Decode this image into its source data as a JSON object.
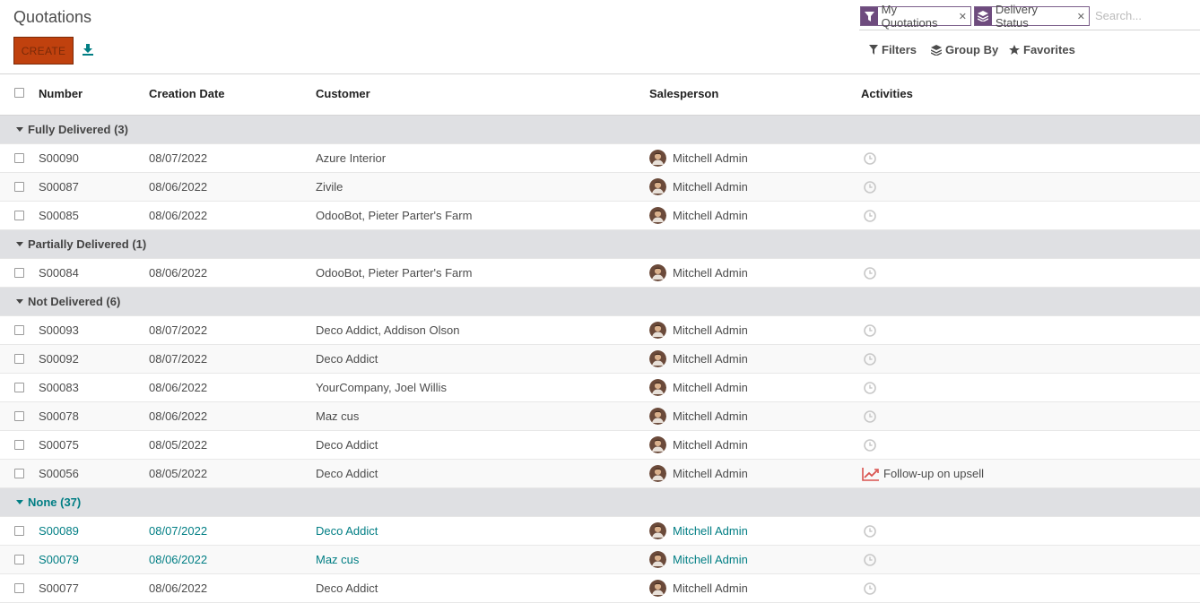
{
  "page": {
    "title": "Quotations"
  },
  "toolbar": {
    "create_label": "CREATE"
  },
  "search": {
    "facets": [
      {
        "label": "My Quotations",
        "icon": "filter-icon"
      },
      {
        "label": "Delivery Status",
        "icon": "layers-icon"
      }
    ],
    "placeholder": "Search...",
    "filters_label": "Filters",
    "groupby_label": "Group By",
    "favorites_label": "Favorites"
  },
  "table": {
    "headers": {
      "number": "Number",
      "date": "Creation Date",
      "customer": "Customer",
      "salesperson": "Salesperson",
      "activities": "Activities"
    },
    "groups": [
      {
        "label": "Fully Delivered (3)",
        "highlight": false,
        "rows": [
          {
            "number": "S00090",
            "date": "08/07/2022",
            "customer": "Azure Interior",
            "salesperson": "Mitchell Admin",
            "activity": ""
          },
          {
            "number": "S00087",
            "date": "08/06/2022",
            "customer": "Zivile",
            "salesperson": "Mitchell Admin",
            "activity": ""
          },
          {
            "number": "S00085",
            "date": "08/06/2022",
            "customer": "OdooBot, Pieter Parter's Farm",
            "salesperson": "Mitchell Admin",
            "activity": ""
          }
        ]
      },
      {
        "label": "Partially Delivered (1)",
        "highlight": false,
        "rows": [
          {
            "number": "S00084",
            "date": "08/06/2022",
            "customer": "OdooBot, Pieter Parter's Farm",
            "salesperson": "Mitchell Admin",
            "activity": ""
          }
        ]
      },
      {
        "label": "Not Delivered (6)",
        "highlight": false,
        "rows": [
          {
            "number": "S00093",
            "date": "08/07/2022",
            "customer": "Deco Addict, Addison Olson",
            "salesperson": "Mitchell Admin",
            "activity": ""
          },
          {
            "number": "S00092",
            "date": "08/07/2022",
            "customer": "Deco Addict",
            "salesperson": "Mitchell Admin",
            "activity": ""
          },
          {
            "number": "S00083",
            "date": "08/06/2022",
            "customer": "YourCompany, Joel Willis",
            "salesperson": "Mitchell Admin",
            "activity": ""
          },
          {
            "number": "S00078",
            "date": "08/06/2022",
            "customer": "Maz cus",
            "salesperson": "Mitchell Admin",
            "activity": ""
          },
          {
            "number": "S00075",
            "date": "08/05/2022",
            "customer": "Deco Addict",
            "salesperson": "Mitchell Admin",
            "activity": ""
          },
          {
            "number": "S00056",
            "date": "08/05/2022",
            "customer": "Deco Addict",
            "salesperson": "Mitchell Admin",
            "activity": "Follow-up on upsell"
          }
        ]
      },
      {
        "label": "None (37)",
        "highlight": true,
        "rows": [
          {
            "number": "S00089",
            "date": "08/07/2022",
            "customer": "Deco Addict",
            "salesperson": "Mitchell Admin",
            "activity": "",
            "teal": true
          },
          {
            "number": "S00079",
            "date": "08/06/2022",
            "customer": "Maz cus",
            "salesperson": "Mitchell Admin",
            "activity": "",
            "teal": true
          },
          {
            "number": "S00077",
            "date": "08/06/2022",
            "customer": "Deco Addict",
            "salesperson": "Mitchell Admin",
            "activity": ""
          }
        ]
      }
    ]
  },
  "colors": {
    "accent": "#017e84",
    "create": "#c0410e",
    "facet": "#6e4b7e",
    "group_bg": "#dfe0e3"
  }
}
